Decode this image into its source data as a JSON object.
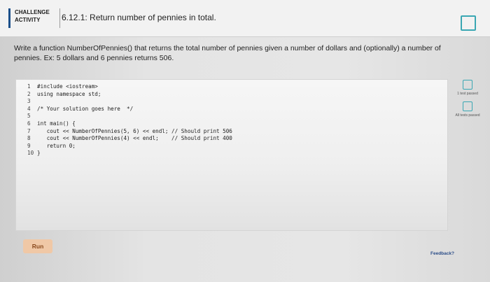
{
  "header": {
    "activity_label_line1": "CHALLENGE",
    "activity_label_line2": "ACTIVITY",
    "title": "6.12.1: Return number of pennies in total."
  },
  "description": "Write a function NumberOfPennies() that returns the total number of pennies given a number of dollars and (optionally) a number of pennies. Ex: 5 dollars and 6 pennies returns 506.",
  "code_lines": [
    {
      "n": "1",
      "text": "#include <iostream>"
    },
    {
      "n": "2",
      "text": "using namespace std;"
    },
    {
      "n": "3",
      "text": ""
    },
    {
      "n": "4",
      "text": "/* Your solution goes here  */"
    },
    {
      "n": "5",
      "text": ""
    },
    {
      "n": "6",
      "text": "int main() {"
    },
    {
      "n": "7",
      "text": "   cout << NumberOfPennies(5, 6) << endl; // Should print 506"
    },
    {
      "n": "8",
      "text": "   cout << NumberOfPennies(4) << endl;    // Should print 400"
    },
    {
      "n": "9",
      "text": "   return 0;"
    },
    {
      "n": "10",
      "text": "}"
    }
  ],
  "side": {
    "test1_label": "1 test passed",
    "test2_label": "All tests passed"
  },
  "run_label": "Run",
  "feedback_label": "Feedback?"
}
